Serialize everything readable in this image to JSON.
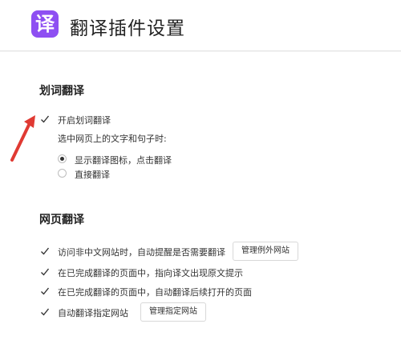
{
  "header": {
    "logo_char": "译",
    "title": "翻译插件设置",
    "accent_color": "#8e4ff2"
  },
  "word_translate": {
    "section_title": "划词翻译",
    "enable_label": "开启划词翻译",
    "enable_checked": true,
    "selection_hint": "选中网页上的文字和句子时:",
    "options": [
      {
        "label": "显示翻译图标，点击翻译",
        "selected": true
      },
      {
        "label": "直接翻译",
        "selected": false
      }
    ]
  },
  "page_translate": {
    "section_title": "网页翻译",
    "options": [
      {
        "label": "访问非中文网站时，自动提醒是否需要翻译",
        "checked": true,
        "button": "管理例外网站"
      },
      {
        "label": "在已完成翻译的页面中，指向译文出现原文提示",
        "checked": true
      },
      {
        "label": "在已完成翻译的页面中，自动翻译后续打开的页面",
        "checked": true
      },
      {
        "label": "自动翻译指定网站",
        "checked": true,
        "button": "管理指定网站"
      }
    ]
  },
  "annotation": {
    "arrow_color": "#e03a33",
    "icon": "red-arrow-icon"
  }
}
